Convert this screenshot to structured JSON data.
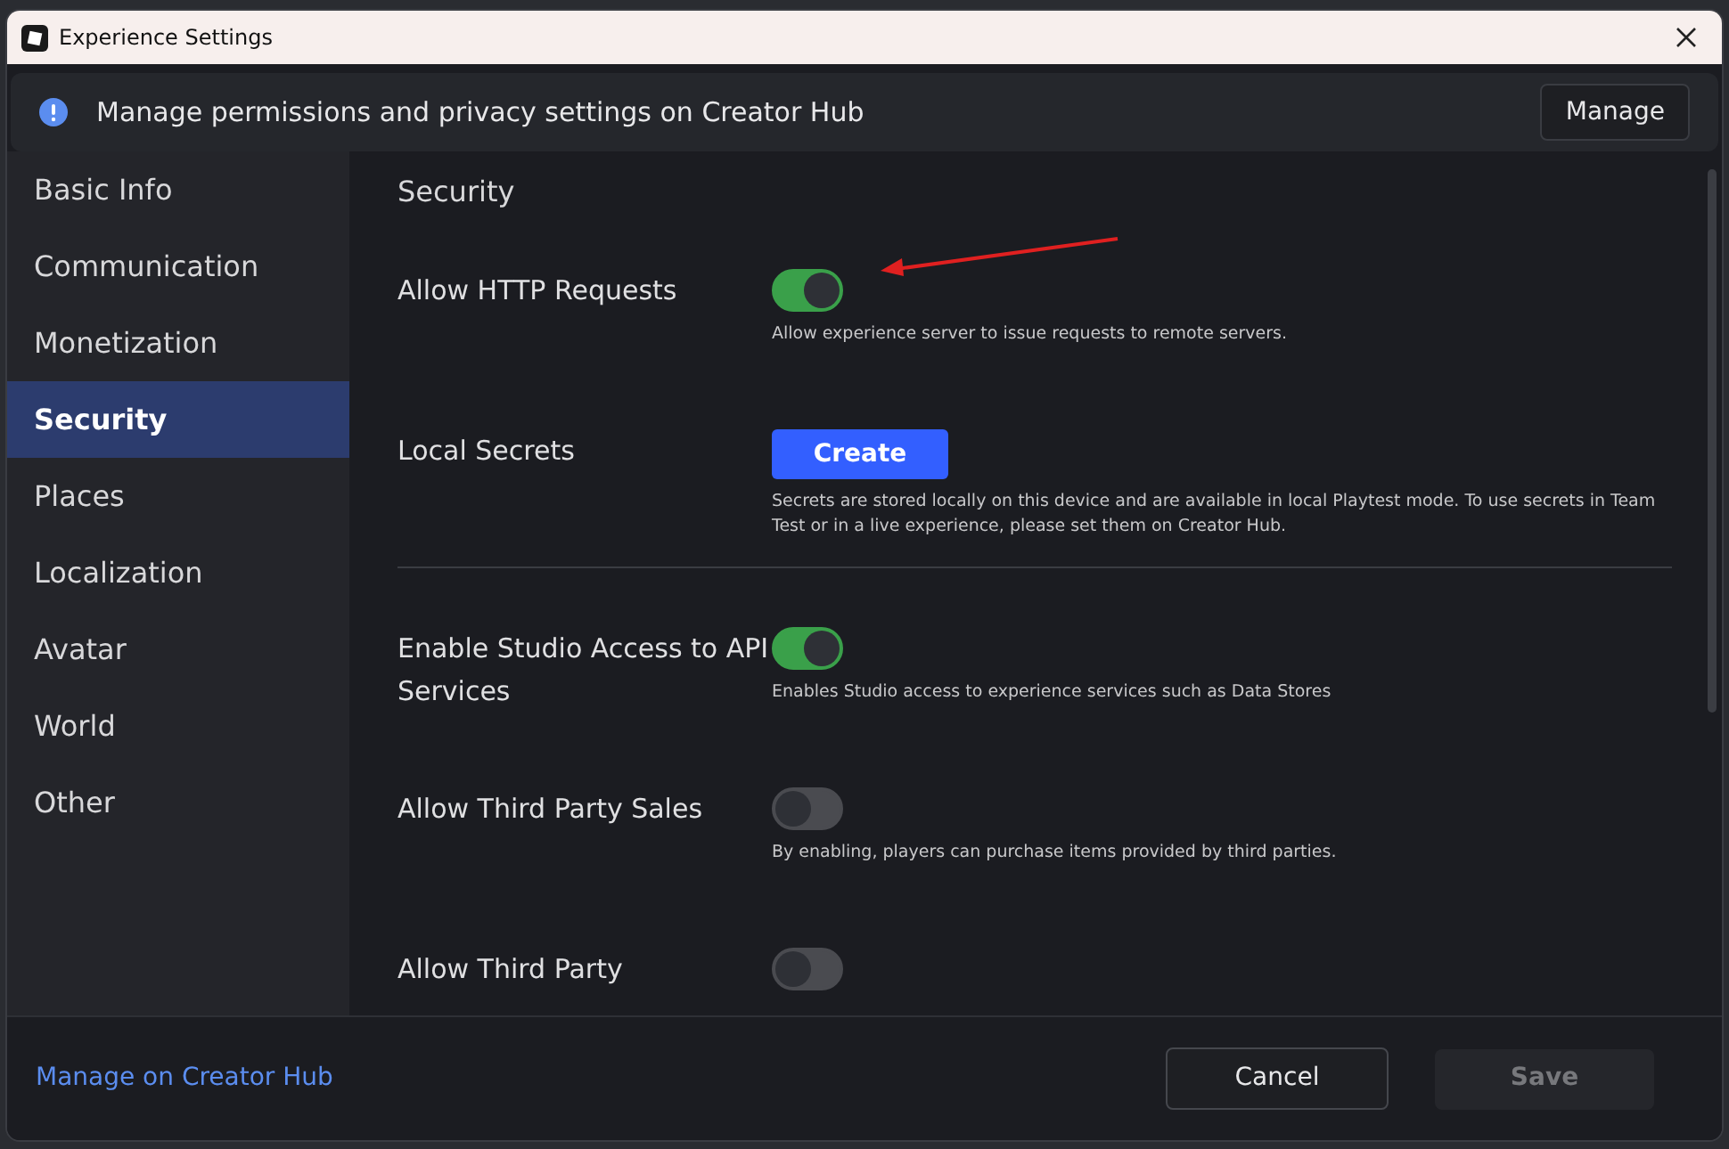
{
  "window": {
    "title": "Experience Settings"
  },
  "banner": {
    "text": "Manage permissions and privacy settings on Creator Hub",
    "button": "Manage"
  },
  "sidebar": {
    "items": [
      {
        "label": "Basic Info",
        "selected": false
      },
      {
        "label": "Communication",
        "selected": false
      },
      {
        "label": "Monetization",
        "selected": false
      },
      {
        "label": "Security",
        "selected": true
      },
      {
        "label": "Places",
        "selected": false
      },
      {
        "label": "Localization",
        "selected": false
      },
      {
        "label": "Avatar",
        "selected": false
      },
      {
        "label": "World",
        "selected": false
      },
      {
        "label": "Other",
        "selected": false
      }
    ]
  },
  "section_title": "Security",
  "settings": [
    {
      "kind": "toggle",
      "label": "Allow HTTP Requests",
      "on": true,
      "description": "Allow experience server to issue requests to remote servers."
    },
    {
      "kind": "button",
      "label": "Local Secrets",
      "button": "Create",
      "description": "Secrets are stored locally on this device and are available in local Playtest mode. To use secrets in Team Test or in a live experience, please set them on Creator Hub.",
      "divider": true
    },
    {
      "kind": "toggle",
      "label": "Enable Studio Access to API Services",
      "on": true,
      "description": "Enables Studio access to experience services such as Data Stores"
    },
    {
      "kind": "toggle",
      "label": "Allow Third Party Sales",
      "on": false,
      "description": "By enabling, players can purchase items provided by third parties."
    },
    {
      "kind": "toggle",
      "label": "Allow Third Party",
      "on": false
    }
  ],
  "footer": {
    "link": "Manage on Creator Hub",
    "cancel": "Cancel",
    "save": "Save",
    "save_disabled": true
  }
}
